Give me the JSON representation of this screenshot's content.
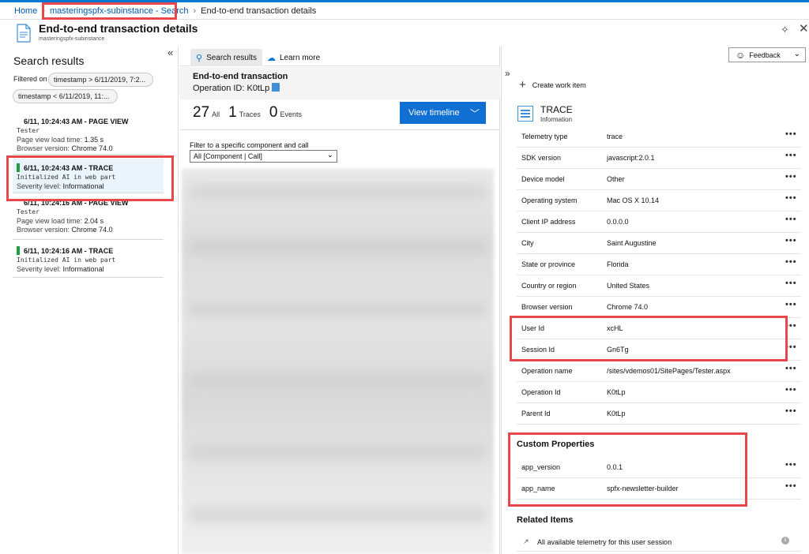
{
  "breadcrumb": {
    "home": "Home",
    "search": "masteringspfx-subinstance - Search",
    "current": "End-to-end transaction details"
  },
  "header": {
    "title": "End-to-end transaction details",
    "subtitle": "masteringspfx-subinstance",
    "icons": [
      "document-icon",
      "pin-icon",
      "close-icon"
    ]
  },
  "left": {
    "heading": "Search results",
    "filtered_on": "Filtered on",
    "filters": [
      "timestamp > 6/11/2019, 7:2...",
      "timestamp < 6/11/2019, 11:..."
    ],
    "results": [
      {
        "title": "6/11, 10:24:43 AM - PAGE VIEW",
        "name": "Tester",
        "line1_k": "Page view load time:",
        "line1_v": "1.35 s",
        "line2_k": "Browser version:",
        "line2_v": "Chrome 74.0"
      },
      {
        "title": "6/11, 10:24:43 AM - TRACE",
        "name": "Initialized AI in web part",
        "line1_k": "Severity level:",
        "line1_v": "Informational"
      },
      {
        "title": "6/11, 10:24:16 AM - PAGE VIEW",
        "name": "Tester",
        "line1_k": "Page view load time:",
        "line1_v": "2.04 s",
        "line2_k": "Browser version:",
        "line2_v": "Chrome 74.0"
      },
      {
        "title": "6/11, 10:24:16 AM - TRACE",
        "name": "Initialized AI in web part",
        "line1_k": "Severity level:",
        "line1_v": "Informational"
      }
    ]
  },
  "middle": {
    "tabs": [
      "Search results",
      "Learn more"
    ],
    "section_title": "End-to-end transaction",
    "operation_id": "Operation ID: K0tLp",
    "counts": [
      {
        "n": "27",
        "label": "All"
      },
      {
        "n": "1",
        "label": "Traces"
      },
      {
        "n": "0",
        "label": "Events"
      }
    ],
    "view_timeline": "View timeline",
    "filter_label": "Filter to a specific component and call",
    "filter_value": "All [Component | Call]"
  },
  "right": {
    "create_work_item": "Create work item",
    "trace_title": "TRACE",
    "trace_subtitle": "Information",
    "properties": [
      {
        "k": "Telemetry type",
        "v": "trace"
      },
      {
        "k": "SDK version",
        "v": "javascript:2.0.1"
      },
      {
        "k": "Device model",
        "v": "Other"
      },
      {
        "k": "Operating system",
        "v": "Mac OS X 10.14"
      },
      {
        "k": "Client IP address",
        "v": "0.0.0.0"
      },
      {
        "k": "City",
        "v": "Saint Augustine"
      },
      {
        "k": "State or province",
        "v": "Florida"
      },
      {
        "k": "Country or region",
        "v": "United States"
      },
      {
        "k": "Browser version",
        "v": "Chrome 74.0"
      },
      {
        "k": "User Id",
        "v": "xcHL"
      },
      {
        "k": "Session Id",
        "v": "Gn6Tg"
      },
      {
        "k": "Operation name",
        "v": "/sites/vdemos01/SitePages/Tester.aspx"
      },
      {
        "k": "Operation Id",
        "v": "K0tLp"
      },
      {
        "k": "Parent Id",
        "v": "K0tLp"
      }
    ],
    "custom_properties_title": "Custom Properties",
    "custom_properties": [
      {
        "k": "app_version",
        "v": "0.0.1"
      },
      {
        "k": "app_name",
        "v": "spfx-newsletter-builder"
      }
    ],
    "related_items_title": "Related Items",
    "related_item": "All available telemetry for this user session",
    "more": "•••"
  },
  "feedback": "Feedback",
  "colors": {
    "accent": "#0f6fd3",
    "highlight": "#e8474c",
    "trace_bar": "#1e9e3e"
  }
}
